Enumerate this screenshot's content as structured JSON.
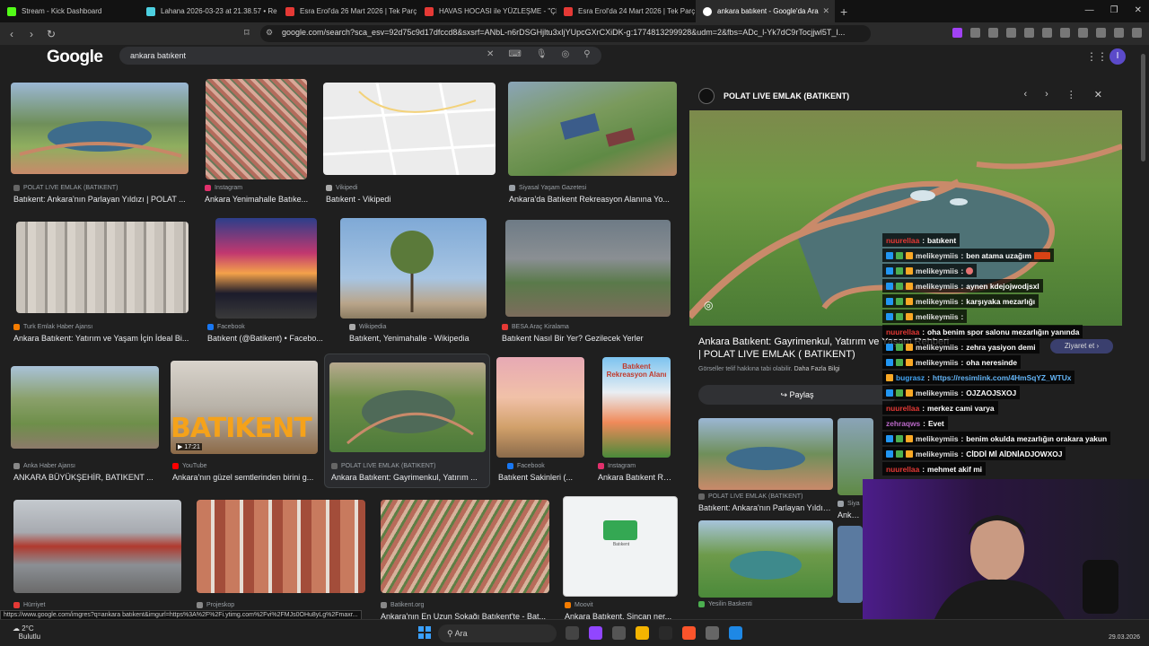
{
  "tabs": [
    {
      "label": "Stream - Kick Dashboard",
      "color": "#53fc18"
    },
    {
      "label": "Lahana 2026-03-23 at 21.38.57 • Re",
      "color": "#4dd0e1"
    },
    {
      "label": "Esra Erol'da 26 Mart 2026 | Tek Parç",
      "color": "#e53935"
    },
    {
      "label": "HAVAS HOCASI ile YÜZLEŞME - \"ÇIN",
      "color": "#e53935"
    },
    {
      "label": "Esra Erol'da 24 Mart 2026 | Tek Parç",
      "color": "#e53935"
    },
    {
      "label": "ankara batıkent - Google'da Ara",
      "color": "#ffffff"
    }
  ],
  "newtab": "+",
  "url": "google.com/search?sca_esv=92d75c9d17dfccd8&sxsrf=ANbL-n6rDSGHjltu3xIjYUpcGXrCXiDK-g:1774813299928&udm=2&fbs=ADc_l-Yk7dC9rTocjjwl5T_I...",
  "google": {
    "logo": "Google",
    "query": "ankara batıkent",
    "avatar": "I"
  },
  "results": [
    {
      "src": "POLAT LIVE EMLAK (BATIKENT)",
      "title": "Batıkent: Ankara'nın Parlayan Yıldızı | POLAT ...",
      "srccolor": "#666"
    },
    {
      "src": "Instagram",
      "title": "Ankara Yenimahalle Batıke...",
      "srccolor": "#e1306c"
    },
    {
      "src": "Vikipedi",
      "title": "Batıkent - Vikipedi",
      "srccolor": "#aaa"
    },
    {
      "src": "Siyasal Yaşam Gazetesi",
      "title": "Ankara'da Batıkent Rekreasyon Alanına Yo...",
      "srccolor": "#9aa0a6"
    },
    {
      "src": "Turk Emlak Haber Ajansı",
      "title": "Ankara Batıkent: Yatırım ve Yaşam İçin İdeal Bi...",
      "srccolor": "#f57c00"
    },
    {
      "src": "Facebook",
      "title": "Batıkent (@Batikent) • Facebo...",
      "srccolor": "#1877f2"
    },
    {
      "src": "Wikipedia",
      "title": "Batıkent, Yenimahalle - Wikipedia",
      "srccolor": "#aaa"
    },
    {
      "src": "BESA Araç Kiralama",
      "title": "Batıkent Nasıl Bir Yer? Gezilecek Yerler",
      "srccolor": "#e53935"
    },
    {
      "src": "Anka Haber Ajansı",
      "title": "ANKARA BÜYÜKŞEHİR, BATIKENT ...",
      "srccolor": "#888"
    },
    {
      "src": "YouTube",
      "title": "Ankara'nın güzel semtlerinden birini g...",
      "srccolor": "#ff0000",
      "overlay": "BATIKENT",
      "dur": "▶ 17:21"
    },
    {
      "src": "POLAT LIVE EMLAK (BATIKENT)",
      "title": "Ankara Batıkent: Gayrimenkul, Yatırım ...",
      "srccolor": "#666"
    },
    {
      "src": "Facebook",
      "title": "Batıkent Sakinleri (...",
      "srccolor": "#1877f2"
    },
    {
      "src": "Instagram",
      "title": "Ankara Batıkent Rekreasy...",
      "srccolor": "#e1306c",
      "overlay": "Batıkent Rekreasyon Alanı"
    },
    {
      "src": "Hürriyet",
      "title": "",
      "srccolor": "#e53935"
    },
    {
      "src": "Projeskop",
      "title": "",
      "srccolor": "#888"
    },
    {
      "src": "Batikent.org",
      "title": "Ankara'nın En Uzun Sokağı Batıkent'te - Bat...",
      "srccolor": "#888"
    },
    {
      "src": "Moovit",
      "title": "Ankara Batıkent, Sincan ner...",
      "srccolor": "#f57c00"
    }
  ],
  "panel": {
    "source": "POLAT LIVE EMLAK (BATIKENT)",
    "title": "Ankara Batıkent: Gayrimenkul, Yatırım ve Yaşam Rehberi | POLAT LIVE EMLAK ( BATIKENT)",
    "disclaimer": "Görseller telif hakkına tabi olabilir.",
    "more": "Daha Fazla Bilgi",
    "share": "Paylaş",
    "visit": "Ziyaret et",
    "related": [
      {
        "src": "POLAT LIVE EMLAK (BATIKENT)",
        "title": "Batıkent: Ankara'nın Parlayan Yıldızı | ..."
      },
      {
        "src": "Siya",
        "title": "Ankara"
      },
      {
        "src": "Yesilin Baskenti",
        "title": ""
      }
    ]
  },
  "chat": [
    {
      "user": "nuurellaa",
      "msg": "batıkent",
      "ucolor": "#e53935",
      "badges": 0
    },
    {
      "user": "melikeymiis",
      "msg": "ben atama uzağım",
      "ucolor": "#e0e0e0",
      "badges": 3
    },
    {
      "user": "melikeymiis",
      "msg": "",
      "ucolor": "#e0e0e0",
      "badges": 3
    },
    {
      "user": "melikeymiis",
      "msg": "aynen kdejojwodjsxl",
      "ucolor": "#e0e0e0",
      "badges": 3
    },
    {
      "user": "melikeymiis",
      "msg": "karşıyaka mezarlığı",
      "ucolor": "#e0e0e0",
      "badges": 3
    },
    {
      "user": "melikeymiis",
      "msg": "",
      "ucolor": "#e0e0e0",
      "badges": 3
    },
    {
      "user": "nuurellaa",
      "msg": "oha benim spor salonu mezarlığın yanında",
      "ucolor": "#e53935",
      "badges": 0
    },
    {
      "user": "melikeymiis",
      "msg": "zehra yasiyon demi",
      "ucolor": "#e0e0e0",
      "badges": 3
    },
    {
      "user": "melikeymiis",
      "msg": "oha neresinde",
      "ucolor": "#e0e0e0",
      "badges": 3
    },
    {
      "user": "bugrasz",
      "msg": "https://resimlink.com/4HmSqYZ_WTUx",
      "ucolor": "#42a5f5",
      "badges": 1,
      "link": true
    },
    {
      "user": "melikeymiis",
      "msg": "OJZAOJSXOJ",
      "ucolor": "#e0e0e0",
      "badges": 3
    },
    {
      "user": "nuurellaa",
      "msg": "merkez cami varya",
      "ucolor": "#e53935",
      "badges": 0
    },
    {
      "user": "zehraqws",
      "msg": "Evet",
      "ucolor": "#ba68c8",
      "badges": 0
    },
    {
      "user": "melikeymiis",
      "msg": "benim okulda mezarlığın orakara yakun",
      "ucolor": "#e0e0e0",
      "badges": 3
    },
    {
      "user": "melikeymiis",
      "msg": "CİDDİ Mİ AİDNİADJOWXOJ",
      "ucolor": "#e0e0e0",
      "badges": 3
    },
    {
      "user": "nuurellaa",
      "msg": "mehmet akif mi",
      "ucolor": "#e53935",
      "badges": 0
    }
  ],
  "statusbar": "https://www.google.com/imgres?q=ankara batıkent&imgurl=https%3A%2F%2Fi.ytimg.com%2Fvi%2FMJs0OHu8yLg%2Fmaxr...",
  "taskbar": {
    "temp": "2°C",
    "weather": "Bulutlu",
    "search": "Ara",
    "date": "29.03.2026"
  },
  "map": {
    "label": "Batıkent"
  }
}
